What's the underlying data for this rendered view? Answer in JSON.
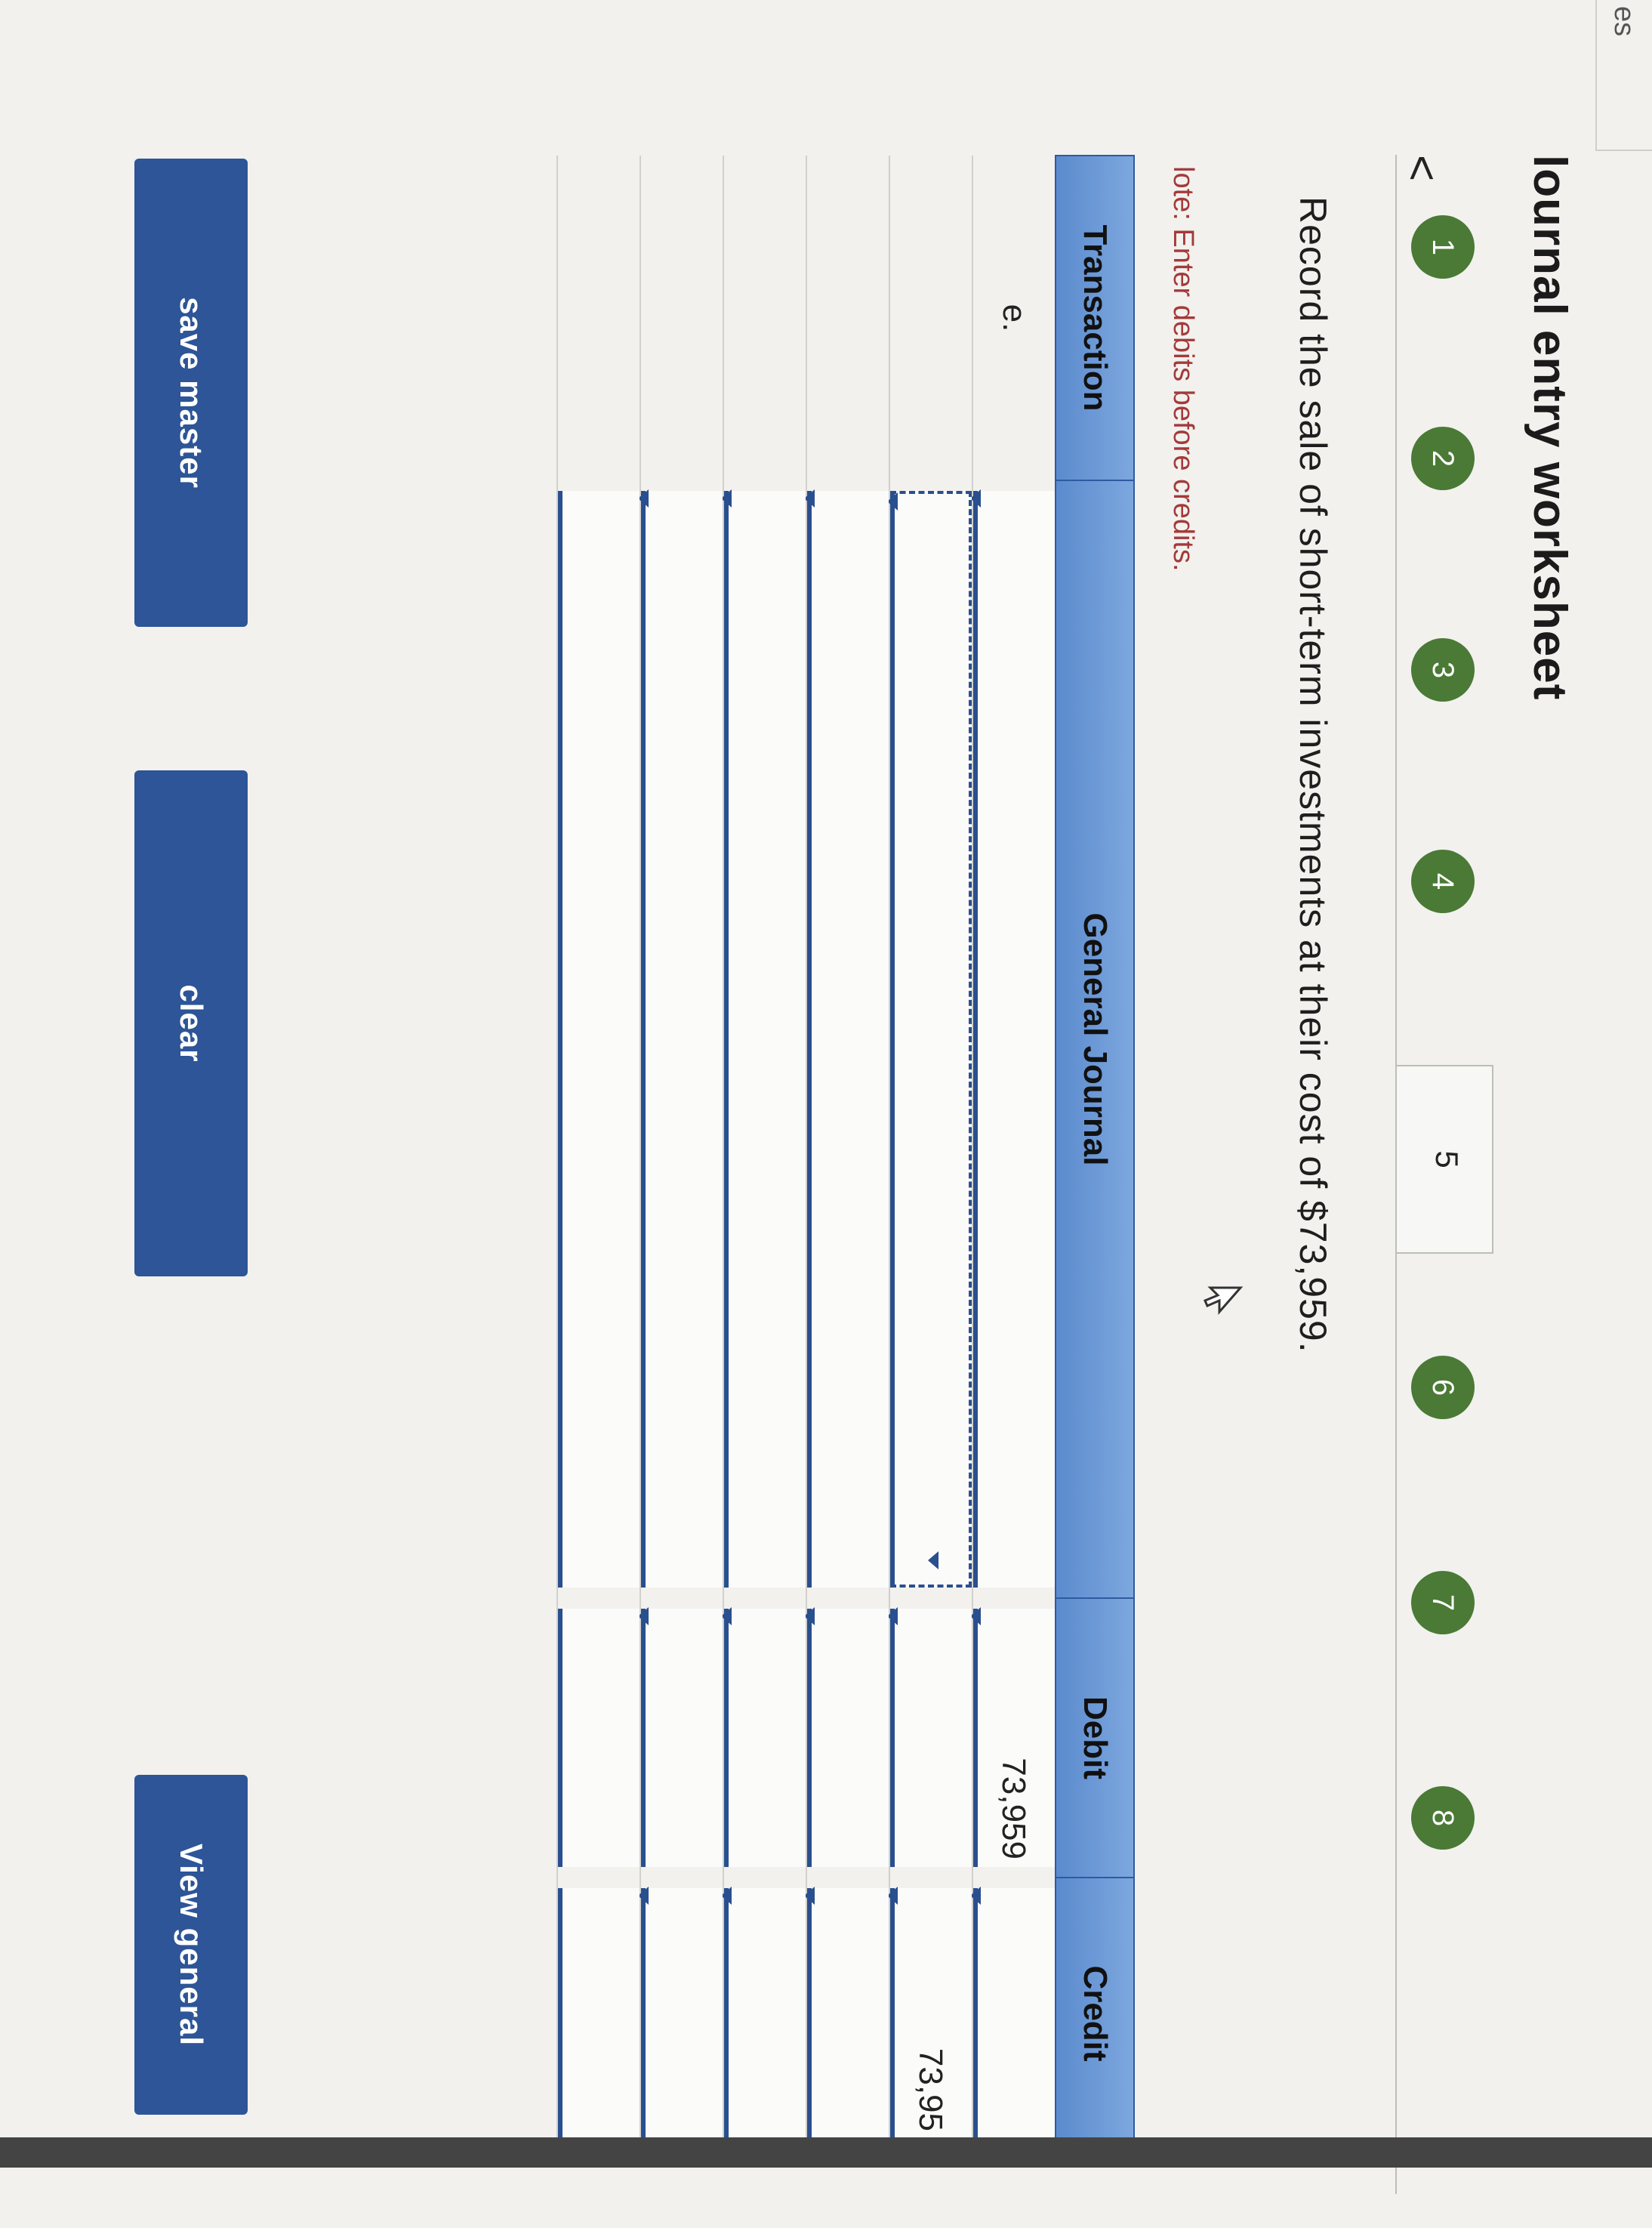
{
  "header": {
    "tab_fragment": "es",
    "title": "lournal entry worksheet",
    "prev_arrow": "<"
  },
  "steps": [
    "1",
    "2",
    "3",
    "4",
    "5",
    "6",
    "7",
    "8"
  ],
  "active_step": "5",
  "prompt": "Record the sale of short-term investments at their cost of $73,959.",
  "note": "lote: Enter debits before credits.",
  "journal": {
    "headers": {
      "transaction": "Transaction",
      "account": "General Journal",
      "debit": "Debit",
      "credit": "Credit"
    },
    "rows": [
      {
        "transaction": "e.",
        "account": "",
        "debit": "73,959",
        "credit": ""
      },
      {
        "transaction": "",
        "account": "",
        "debit": "",
        "credit": "73,95"
      },
      {
        "transaction": "",
        "account": "",
        "debit": "",
        "credit": ""
      },
      {
        "transaction": "",
        "account": "",
        "debit": "",
        "credit": ""
      },
      {
        "transaction": "",
        "account": "",
        "debit": "",
        "credit": ""
      },
      {
        "transaction": "",
        "account": "",
        "debit": "",
        "credit": ""
      }
    ]
  },
  "buttons": {
    "save": "save master",
    "clear": "clear",
    "view": "View general"
  },
  "colors": {
    "step_green": "#4a7a35",
    "header_blue": "#6a97d6",
    "button_blue": "#2d5597",
    "note_red": "#a33a3a"
  }
}
